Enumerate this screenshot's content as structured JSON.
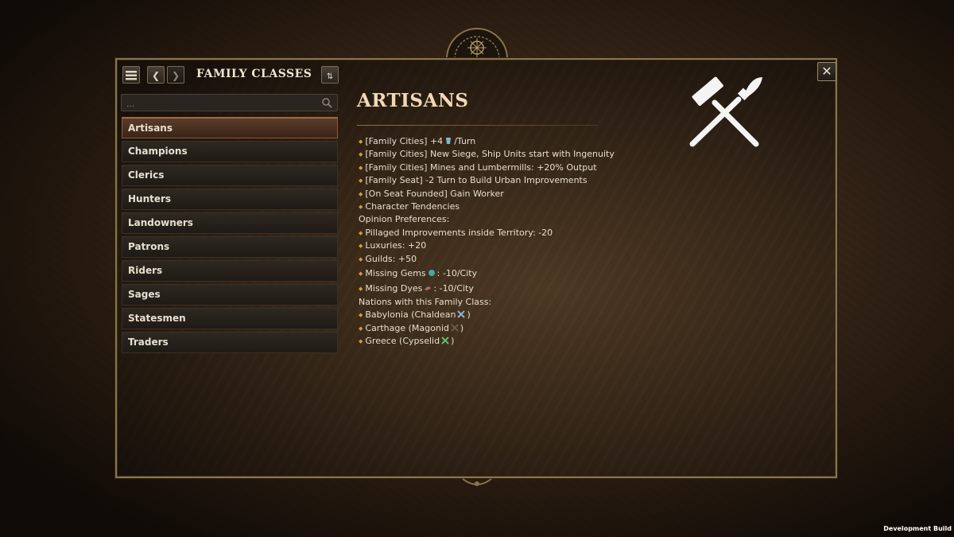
{
  "panel": {
    "title": "FAMILY CLASSES",
    "search_placeholder": "...",
    "items": [
      {
        "label": "Artisans",
        "selected": true
      },
      {
        "label": "Champions"
      },
      {
        "label": "Clerics"
      },
      {
        "label": "Hunters"
      },
      {
        "label": "Landowners"
      },
      {
        "label": "Patrons"
      },
      {
        "label": "Riders"
      },
      {
        "label": "Sages"
      },
      {
        "label": "Statesmen"
      },
      {
        "label": "Traders"
      }
    ]
  },
  "detail": {
    "title": "ARTISANS",
    "icon": "hammer-and-brush-icon",
    "lines": {
      "l1_pre": "[Family Cities] +4",
      "l1_post": "/Turn",
      "l2": "[Family Cities] New Siege, Ship Units start with Ingenuity",
      "l3": "[Family Cities] Mines and Lumbermills: +20% Output",
      "l4": "[Family Seat] -2 Turn to Build Urban Improvements",
      "l5": "[On Seat Founded] Gain Worker",
      "l6": "Character Tendencies",
      "h1": "Opinion Preferences:",
      "l7": "Pillaged Improvements inside Territory: -20",
      "l8": "Luxuries: +20",
      "l9": "Guilds: +50",
      "l10_pre": "Missing Gems",
      "l10_post": ": -10/City",
      "l11_pre": "Missing Dyes",
      "l11_post": ": -10/City",
      "h2": "Nations with this Family Class:",
      "n1_pre": "Babylonia (Chaldean",
      "n2_pre": "Carthage (Magonid",
      "n3_pre": "Greece (Cypselid",
      "close_paren": ")"
    }
  },
  "footer": {
    "dev_build": "Development Build"
  },
  "colors": {
    "accent_title": "#f2d9b5",
    "bullet": "#d49a3a",
    "selected_item": "#5a3d2a"
  }
}
